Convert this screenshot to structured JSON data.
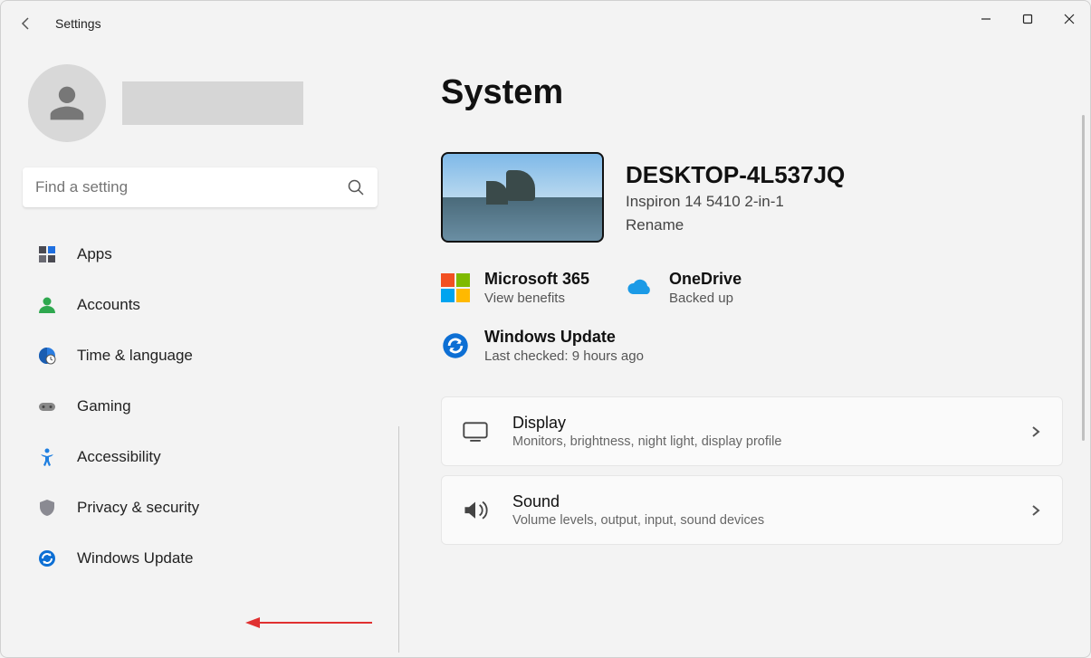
{
  "app_title": "Settings",
  "search": {
    "placeholder": "Find a setting"
  },
  "sidebar": {
    "items": [
      {
        "label": "Apps"
      },
      {
        "label": "Accounts"
      },
      {
        "label": "Time & language"
      },
      {
        "label": "Gaming"
      },
      {
        "label": "Accessibility"
      },
      {
        "label": "Privacy & security"
      },
      {
        "label": "Windows Update"
      }
    ]
  },
  "main": {
    "title": "System",
    "device": {
      "name": "DESKTOP-4L537JQ",
      "model": "Inspiron 14 5410 2-in-1",
      "rename": "Rename"
    },
    "status": {
      "m365": {
        "title": "Microsoft 365",
        "sub": "View benefits"
      },
      "onedrive": {
        "title": "OneDrive",
        "sub": "Backed up"
      },
      "update": {
        "title": "Windows Update",
        "sub": "Last checked: 9 hours ago"
      }
    },
    "cards": {
      "display": {
        "title": "Display",
        "sub": "Monitors, brightness, night light, display profile"
      },
      "sound": {
        "title": "Sound",
        "sub": "Volume levels, output, input, sound devices"
      }
    }
  }
}
